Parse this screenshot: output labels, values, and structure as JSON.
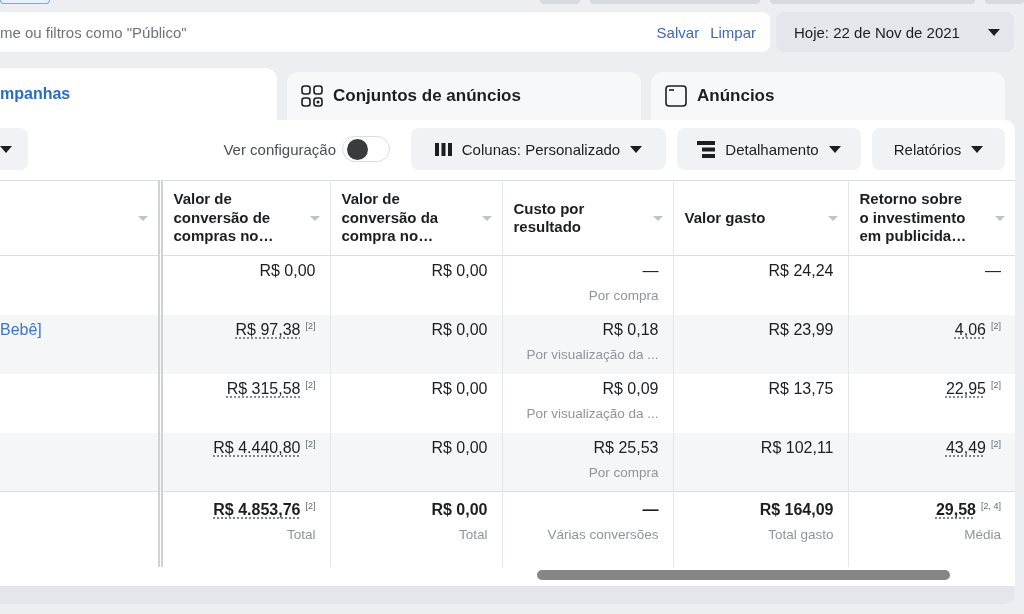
{
  "filter_bar": {
    "search": {
      "placeholder": "me ou filtros como \"Público\""
    },
    "save_link": "Salvar",
    "clear_link": "Limpar",
    "date_button": "Hoje: 22 de Nov de 2021"
  },
  "tabs": [
    {
      "label": "mpanhas",
      "kind": "campaigns",
      "selected": true
    },
    {
      "label": "Conjuntos de anúncios",
      "kind": "ad_sets",
      "selected": false
    },
    {
      "label": "Anúncios",
      "kind": "ads",
      "selected": false
    }
  ],
  "toolbar": {
    "toggle": {
      "label": "Ver configuração",
      "on": false
    },
    "buttons": [
      {
        "label": "Colunas: Personalizado",
        "kind": "columns"
      },
      {
        "label": "Detalhamento",
        "kind": "breakdown"
      },
      {
        "label": "Relatórios",
        "kind": "reports"
      }
    ]
  },
  "table": {
    "columns": [
      "Valor de\nconversão de\ncompras no…",
      "Valor de\nconversão da\ncompra no…",
      "Custo por\nresultado",
      "Valor gasto",
      "Retorno sobre\no investimento\nem publicida…"
    ],
    "rows": [
      {
        "cells": [
          {
            "value": "R$ 0,00"
          },
          {
            "value": "R$ 0,00"
          },
          {
            "value": "—",
            "caption": "Por compra"
          },
          {
            "value": "R$ 24,24"
          },
          {
            "value": "—"
          }
        ]
      },
      {
        "name": "Bebê]",
        "cells": [
          {
            "value": "R$ 97,38",
            "note": "[2]"
          },
          {
            "value": "R$ 0,00"
          },
          {
            "value": "R$ 0,18",
            "caption": "Por visualização da ..."
          },
          {
            "value": "R$ 23,99"
          },
          {
            "value": "4,06",
            "note": "[2]"
          }
        ]
      },
      {
        "cells": [
          {
            "value": "R$ 315,58",
            "note": "[2]"
          },
          {
            "value": "R$ 0,00"
          },
          {
            "value": "R$ 0,09",
            "caption": "Por visualização da ..."
          },
          {
            "value": "R$ 13,75"
          },
          {
            "value": "22,95",
            "note": "[2]"
          }
        ]
      },
      {
        "cells": [
          {
            "value": "R$ 4.440,80",
            "note": "[2]"
          },
          {
            "value": "R$ 0,00"
          },
          {
            "value": "R$ 25,53",
            "caption": "Por compra"
          },
          {
            "value": "R$ 102,11"
          },
          {
            "value": "43,49",
            "note": "[2]"
          }
        ]
      }
    ],
    "totals": [
      {
        "value": "R$ 4.853,76",
        "note": "[2]",
        "caption": "Total"
      },
      {
        "value": "R$ 0,00",
        "caption": "Total"
      },
      {
        "value": "—",
        "caption": "Várias conversões"
      },
      {
        "value": "R$ 164,09",
        "caption": "Total gasto"
      },
      {
        "value": "29,58",
        "note": "[2, 4]",
        "caption": "Média"
      }
    ]
  }
}
